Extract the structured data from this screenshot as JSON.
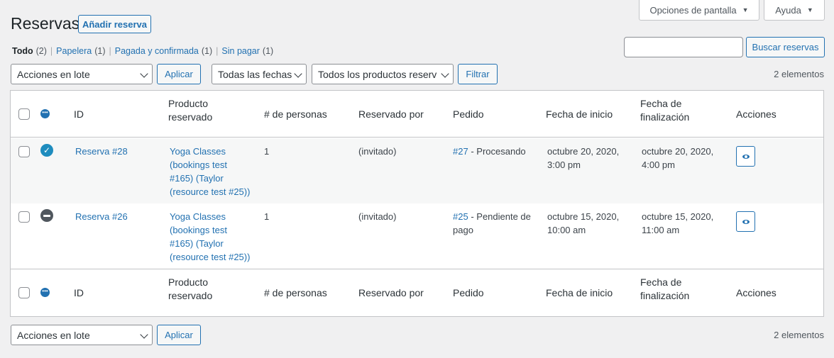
{
  "screen_options": {
    "options_label": "Opciones de pantalla",
    "help_label": "Ayuda"
  },
  "header": {
    "title": "Reservas",
    "add_new_label": "Añadir reserva"
  },
  "views": [
    {
      "label": "Todo",
      "count": "(2)"
    },
    {
      "label": "Papelera",
      "count": "(1)"
    },
    {
      "label": "Pagada y confirmada",
      "count": "(1)"
    },
    {
      "label": "Sin pagar",
      "count": "(1)"
    }
  ],
  "search": {
    "value": "",
    "button_label": "Buscar reservas"
  },
  "filters": {
    "bulk_actions": "Acciones en lote",
    "apply_label": "Aplicar",
    "dates": "Todas las fechas",
    "products": "Todos los productos reserv",
    "filter_label": "Filtrar"
  },
  "items_count": "2 elementos",
  "columns": {
    "id": "ID",
    "product_line1": "Producto",
    "product_line2": "reservado",
    "persons": "# de personas",
    "booked_by": "Reservado por",
    "order": "Pedido",
    "start_date": "Fecha de inicio",
    "end_line1": "Fecha de",
    "end_line2": "finalización",
    "actions": "Acciones"
  },
  "rows": [
    {
      "status": "confirmed",
      "id": "Reserva #28",
      "product": [
        "Yoga Classes",
        "(bookings test",
        "#165) (Taylor",
        "(resource test #25))"
      ],
      "persons": "1",
      "booked_by": "(invitado)",
      "order_link": "#27",
      "order_status": [
        "- Procesando"
      ],
      "start": [
        "octubre 20, 2020,",
        "3:00 pm"
      ],
      "end": [
        "octubre 20, 2020,",
        "4:00 pm"
      ]
    },
    {
      "status": "unpaid",
      "id": "Reserva #26",
      "product": [
        "Yoga Classes",
        "(bookings test",
        "#165) (Taylor",
        "(resource test #25))"
      ],
      "persons": "1",
      "booked_by": "(invitado)",
      "order_link": "#25",
      "order_status": [
        "- Pendiente de",
        "pago"
      ],
      "start": [
        "octubre 15, 2020,",
        "10:00 am"
      ],
      "end": [
        "octubre 15, 2020,",
        "11:00 am"
      ]
    }
  ]
}
